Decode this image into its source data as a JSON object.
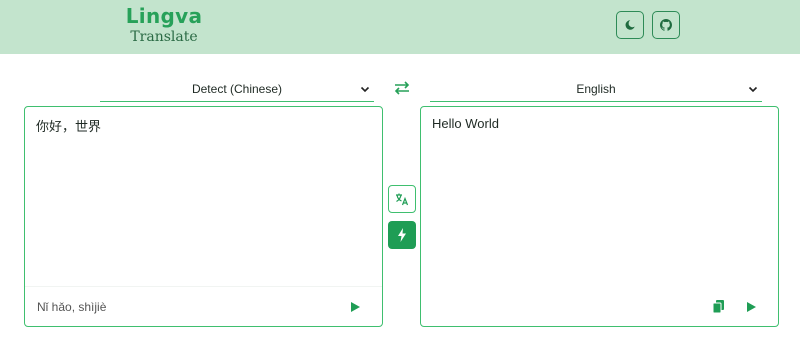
{
  "header": {
    "logo_top": "Lingva",
    "logo_bottom": "Translate",
    "theme_toggle_icon": "moon-icon",
    "github_icon": "github-icon"
  },
  "source": {
    "language": "Detect (Chinese)",
    "text": "你好，世界",
    "transliteration": "Nǐ hǎo, shìjiè"
  },
  "target": {
    "language": "English",
    "text": "Hello World"
  },
  "colors": {
    "header_bg": "#c3e4cd",
    "accent": "#27a159",
    "border": "#3fbf6f",
    "primary_button": "#1f9d55"
  }
}
